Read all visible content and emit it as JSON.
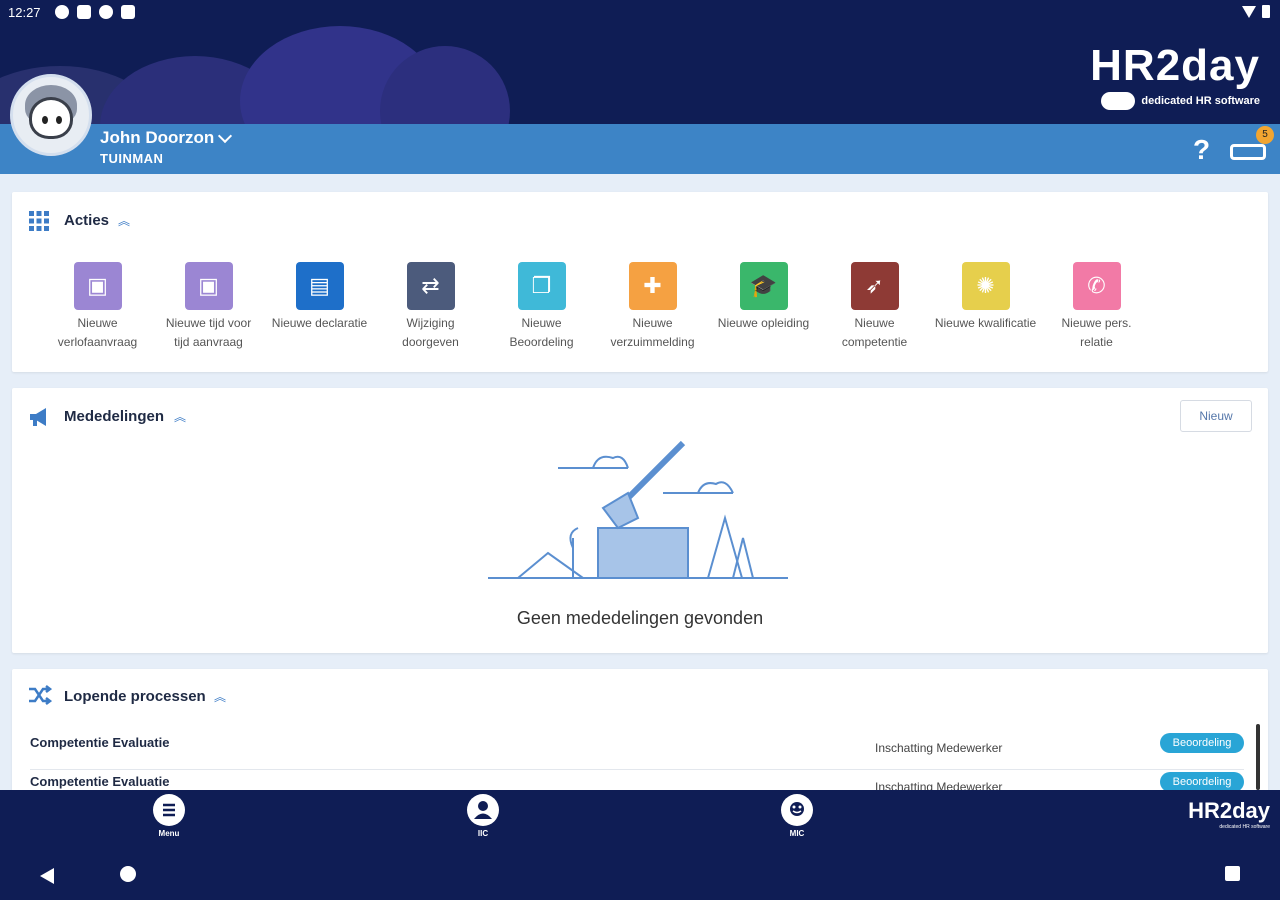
{
  "status_bar": {
    "time": "12:27"
  },
  "header": {
    "logo_name": "HR2day",
    "logo_tagline": "dedicated HR software"
  },
  "user": {
    "name": "John Doorzon",
    "role": "TUINMAN",
    "help_label": "?",
    "notification_count": "5"
  },
  "acties": {
    "title": "Acties",
    "items": [
      {
        "label": "Nieuwe verlofaanvraag",
        "icon": "briefcase-icon",
        "color": "#9b86d3"
      },
      {
        "label": "Nieuwe tijd voor tijd aanvraag",
        "icon": "briefcase-icon",
        "color": "#9b86d3"
      },
      {
        "label": "Nieuwe declaratie",
        "icon": "receipt-icon",
        "color": "#1e6fc9"
      },
      {
        "label": "Wijziging doorgeven",
        "icon": "swap-arrows-icon",
        "color": "#4c5b7c"
      },
      {
        "label": "Nieuwe Beoordeling",
        "icon": "documents-icon",
        "color": "#3fb9d8"
      },
      {
        "label": "Nieuwe verzuimmelding",
        "icon": "medical-kit-icon",
        "color": "#f5a142"
      },
      {
        "label": "Nieuwe opleiding",
        "icon": "graduation-cap-icon",
        "color": "#3ab76b"
      },
      {
        "label": "Nieuwe competentie",
        "icon": "rocket-icon",
        "color": "#8e3a35"
      },
      {
        "label": "Nieuwe kwalificatie",
        "icon": "certificate-icon",
        "color": "#e6cf4c"
      },
      {
        "label": "Nieuwe pers. relatie",
        "icon": "phone-icon",
        "color": "#f27aa6"
      }
    ]
  },
  "mededelingen": {
    "title": "Mededelingen",
    "new_button": "Nieuw",
    "empty_text": "Geen mededelingen gevonden"
  },
  "processen": {
    "title": "Lopende processen",
    "rows": [
      {
        "name": "Competentie Evaluatie",
        "step": "Inschatting Medewerker",
        "badge": "Beoordeling"
      },
      {
        "name": "Competentie Evaluatie",
        "step": "Inschatting Medewerker",
        "badge": "Beoordeling"
      }
    ]
  },
  "bottom_nav": {
    "items": [
      {
        "label": "Menu",
        "icon": "menu-icon"
      },
      {
        "label": "IIC",
        "icon": "person-icon"
      },
      {
        "label": "MIC",
        "icon": "team-icon"
      }
    ],
    "logo": "HR2day",
    "logo_tagline": "dedicated HR software"
  }
}
